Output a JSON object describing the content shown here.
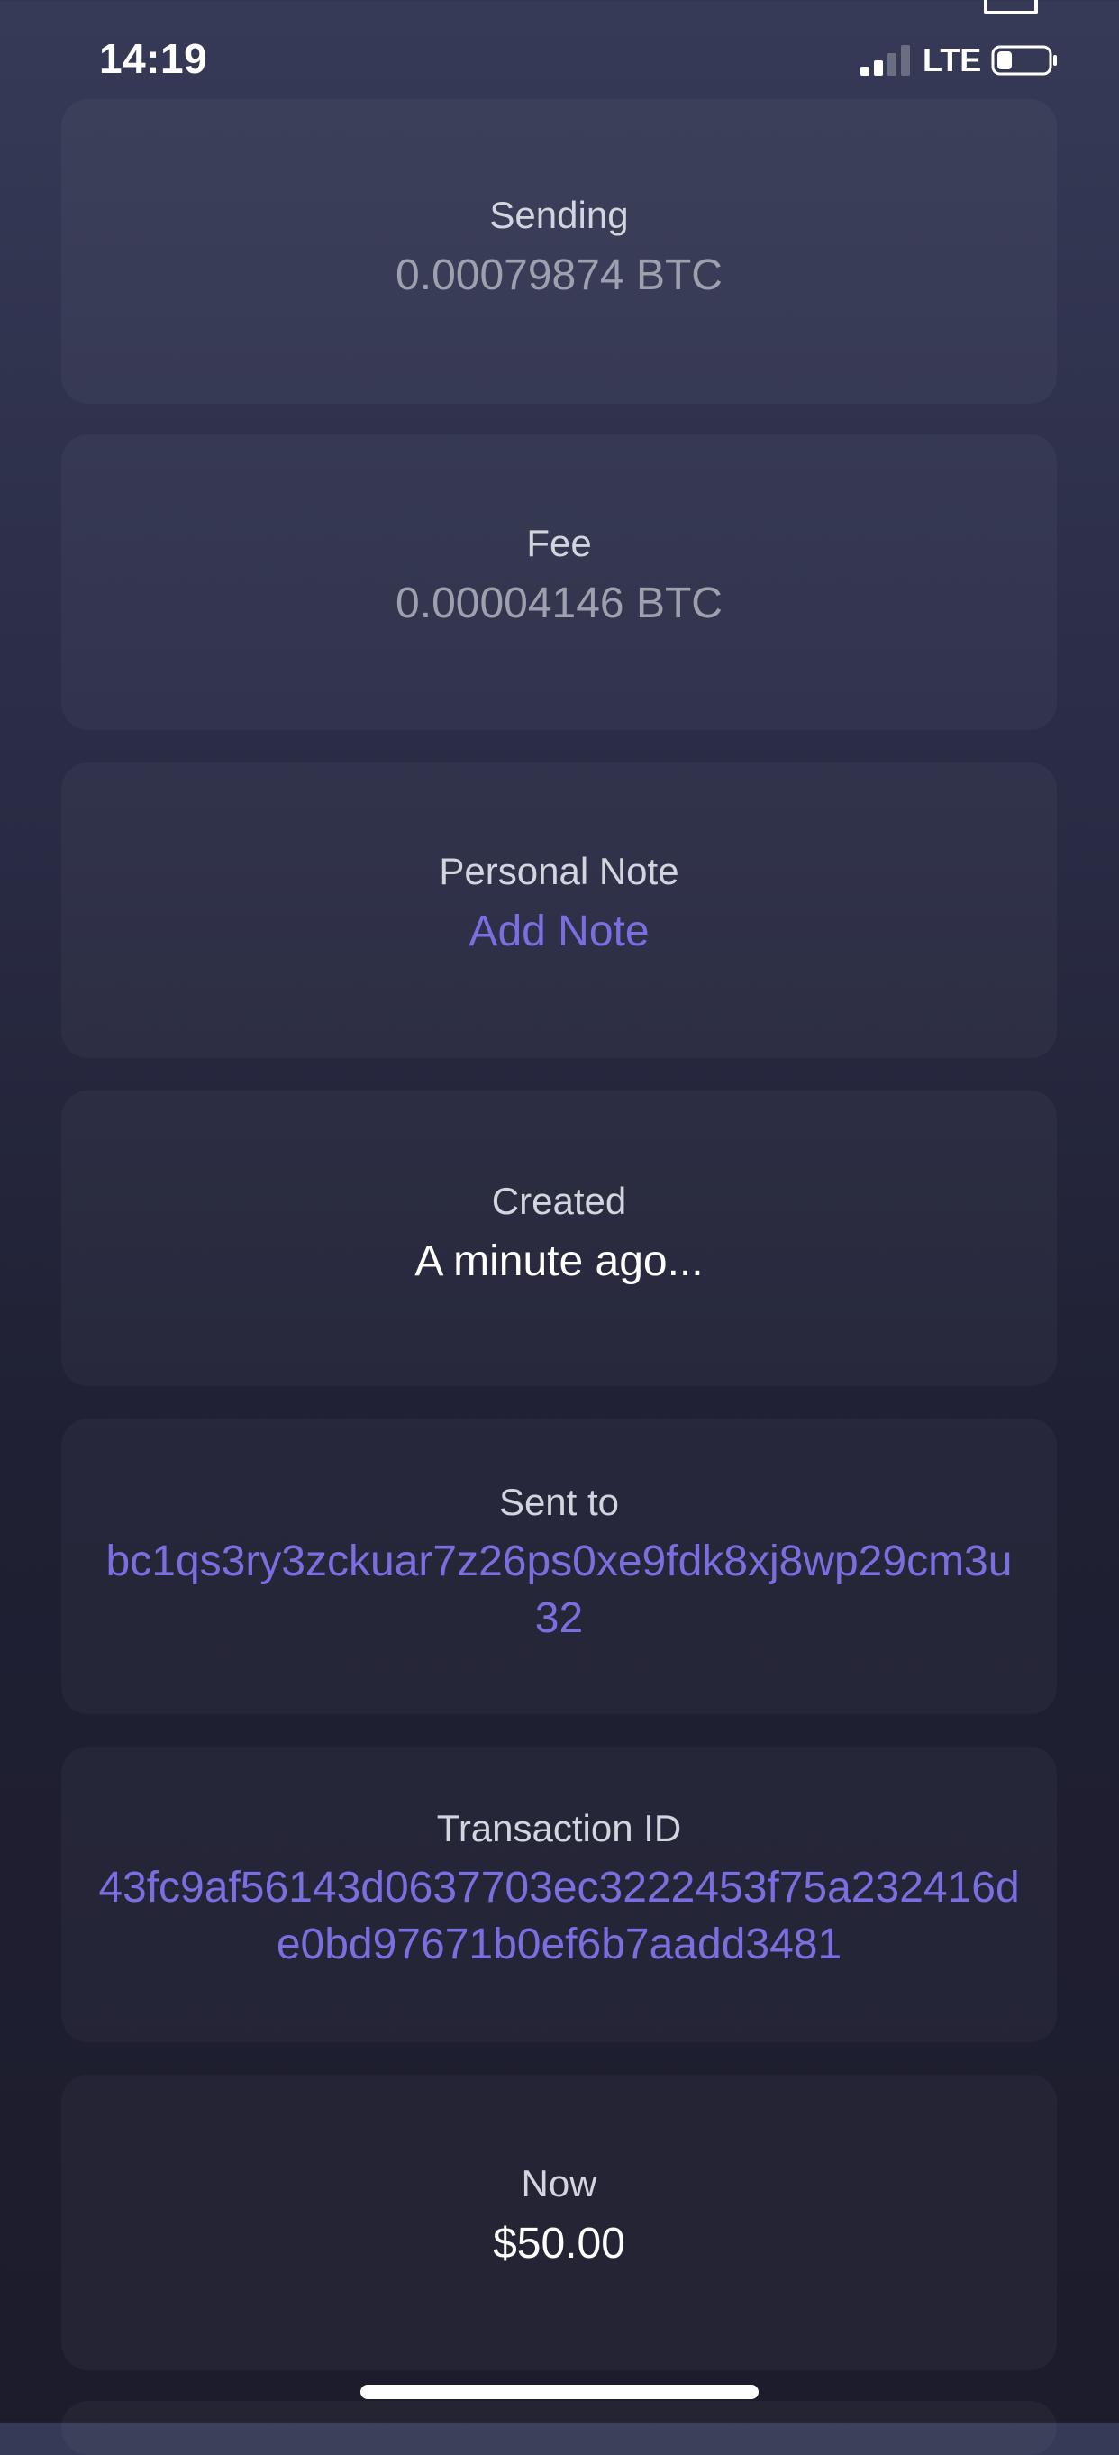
{
  "status_bar": {
    "time": "14:19",
    "network": "LTE",
    "signal_bars": 2,
    "signal_bars_total": 4,
    "battery_level": 0.3
  },
  "details": [
    {
      "label": "Sending",
      "value": "0.00079874 BTC"
    },
    {
      "label": "Fee",
      "value": "0.00004146 BTC"
    },
    {
      "label": "Personal Note",
      "value": "Add Note"
    },
    {
      "label": "Created",
      "value": "A minute ago..."
    },
    {
      "label": "Sent to",
      "value": "bc1qs3ry3zckuar7z26ps0xe9fdk8xj8wp29cm3u32"
    },
    {
      "label": "Transaction ID",
      "value": "43fc9af56143d0637703ec3222453f75a232416de0bd97671b0ef6b7aadd3481"
    },
    {
      "label": "Now",
      "value": "$50.00"
    }
  ],
  "colors": {
    "accent": "#7a6fe0",
    "muted_value": "#9ea0ae",
    "label": "#d2d4de",
    "card_bg": "rgba(255,255,255,0.035)"
  }
}
